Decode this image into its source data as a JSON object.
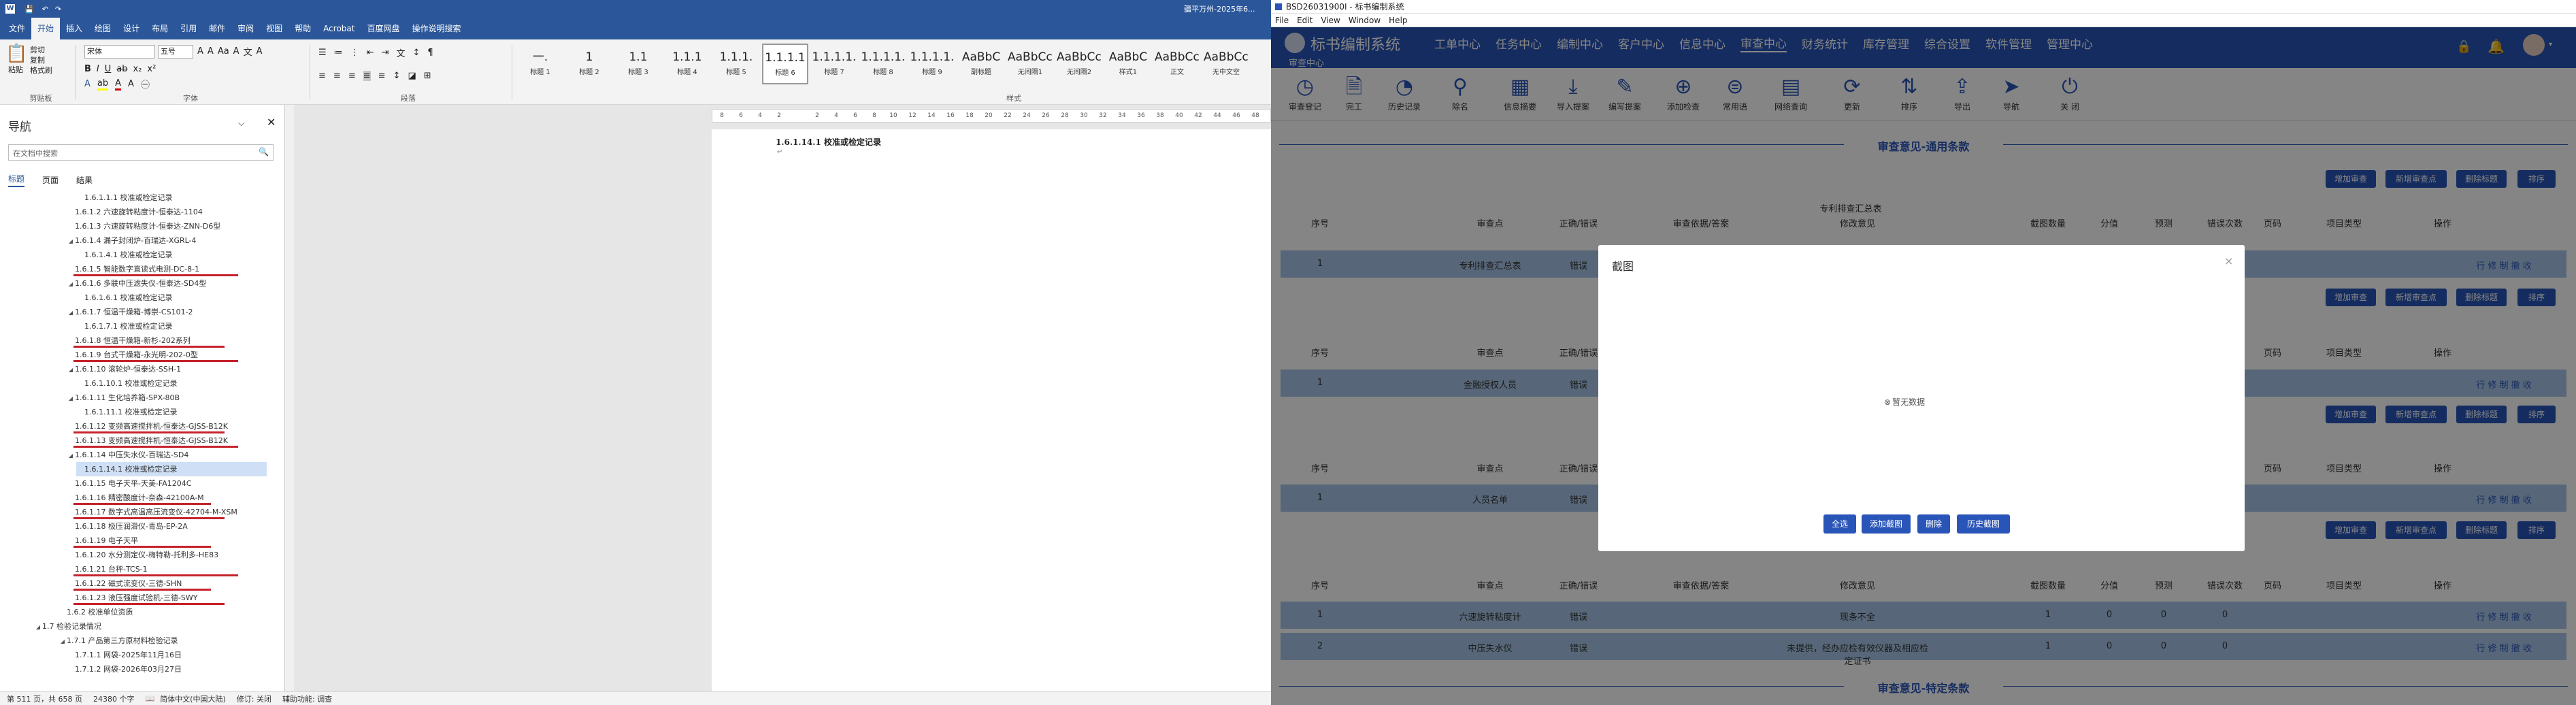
{
  "word": {
    "title": "疆平万州-2025年6...",
    "tabs": [
      "文件",
      "开始",
      "插入",
      "绘图",
      "设计",
      "布局",
      "引用",
      "邮件",
      "审阅",
      "视图",
      "帮助",
      "Acrobat",
      "百度网盘",
      "操作说明搜索"
    ],
    "font_name": "宋体",
    "font_size": "五号",
    "groups": [
      "剪贴板",
      "字体",
      "段落",
      "样式"
    ],
    "paste": "粘贴",
    "clipboard_items": [
      "剪切",
      "复制",
      "格式刷"
    ],
    "styles": [
      {
        "preview": "一.",
        "name": "标题 1"
      },
      {
        "preview": "1",
        "name": "标题 2"
      },
      {
        "preview": "1.1",
        "name": "标题 3"
      },
      {
        "preview": "1.1.1",
        "name": "标题 4"
      },
      {
        "preview": "1.1.1.",
        "name": "标题 5"
      },
      {
        "preview": "1.1.1.1",
        "name": "标题 6"
      },
      {
        "preview": "1.1.1.1.",
        "name": "标题 7"
      },
      {
        "preview": "1.1.1.1.",
        "name": "标题 8"
      },
      {
        "preview": "1.1.1.1.",
        "name": "标题 9"
      },
      {
        "preview": "AaBbC",
        "name": "副标题"
      },
      {
        "preview": "AaBbCcDd",
        "name": "无间隔1"
      },
      {
        "preview": "AaBbCcDd",
        "name": "无间隔2"
      },
      {
        "preview": "AaBbC",
        "name": "样式1"
      },
      {
        "preview": "AaBbCcDd",
        "name": "正文"
      },
      {
        "preview": "AaBbCcDd",
        "name": "无中文空"
      }
    ],
    "nav": {
      "title": "导航",
      "search_placeholder": "在文档中搜索",
      "tabs": [
        "标题",
        "页面",
        "结果"
      ],
      "items": [
        {
          "text": "1.6.1.1.1 校准或检定记录",
          "level": 4
        },
        {
          "text": "1.6.1.2 六速旋转粘度计-恒泰达-1104",
          "level": 3
        },
        {
          "text": "1.6.1.3 六速旋转粘度计-恒泰达-ZNN-D6型",
          "level": 3
        },
        {
          "text": "1.6.1.4 漏子封闭炉-百瑞达-XGRL-4",
          "level": 3
        },
        {
          "text": "1.6.1.4.1 校准或检定记录",
          "level": 4
        },
        {
          "text": "1.6.1.5 智能数字直读式电测-DC-8-1",
          "level": 3
        },
        {
          "text": "1.6.1.6 多联中压滤失仪-恒泰达-SD4型",
          "level": 3
        },
        {
          "text": "1.6.1.6.1 校准或检定记录",
          "level": 4
        },
        {
          "text": "1.6.1.7 恒温干燥箱-博崇-CS101-2",
          "level": 3
        },
        {
          "text": "1.6.1.7.1 校准或检定记录",
          "level": 4
        },
        {
          "text": "1.6.1.8 恒温干燥箱-新杉-202系列",
          "level": 3
        },
        {
          "text": "1.6.1.9 台式干燥箱-永光明-202-0型",
          "level": 3
        },
        {
          "text": "1.6.1.10 滚轮炉-恒泰达-SSH-1",
          "level": 3
        },
        {
          "text": "1.6.1.10.1 校准或检定记录",
          "level": 4
        },
        {
          "text": "1.6.1.11 生化培养箱-SPX-80B",
          "level": 3
        },
        {
          "text": "1.6.1.11.1 校准或检定记录",
          "level": 4
        },
        {
          "text": "1.6.1.12 变频高速搅拌机-恒泰达-GJSS-B12K",
          "level": 3
        },
        {
          "text": "1.6.1.13 变频高速搅拌机-恒泰达-GJSS-B12K",
          "level": 3
        },
        {
          "text": "1.6.1.14 中压失水仪-百瑞达-SD4",
          "level": 3
        },
        {
          "text": "1.6.1.14.1 校准或检定记录",
          "level": 4
        },
        {
          "text": "1.6.1.15 电子天平-天美-FA1204C",
          "level": 3
        },
        {
          "text": "1.6.1.16 精密酸度计-奈森-42100A-M",
          "level": 3
        },
        {
          "text": "1.6.1.17 数字式高温高压流变仪-42704-M-XSM",
          "level": 3
        },
        {
          "text": "1.6.1.18 极压润滑仪-青岛-EP-2A",
          "level": 3
        },
        {
          "text": "1.6.1.19 电子天平",
          "level": 3
        },
        {
          "text": "1.6.1.20 水分测定仪-梅特勒-托利多-HE83",
          "level": 3
        },
        {
          "text": "1.6.1.21 台秤-TCS-1",
          "level": 3
        },
        {
          "text": "1.6.1.22 磁式流变仪-三德-SHN",
          "level": 3
        },
        {
          "text": "1.6.1.23 液压强度试验机-三德-SWY",
          "level": 3
        },
        {
          "text": "1.6.2 校准单位资质",
          "level": 2
        },
        {
          "text": "1.7 检验记录情况",
          "level": 1
        },
        {
          "text": "1.7.1 产品第三方原材料检验记录",
          "level": 2
        },
        {
          "text": "1.7.1.1 网袋-2025年11月16日",
          "level": 3
        },
        {
          "text": "1.7.1.2 网袋-2026年03月27日",
          "level": 3
        }
      ]
    },
    "doc_heading": "1.6.1.14.1 校准或检定记录",
    "ruler_marks": [
      "8",
      "6",
      "4",
      "2",
      "",
      "2",
      "4",
      "6",
      "8",
      "10",
      "12",
      "14",
      "16",
      "18",
      "20",
      "22",
      "24",
      "26",
      "28",
      "30",
      "32",
      "34",
      "36",
      "38",
      "40",
      "42",
      "44",
      "46",
      "48"
    ],
    "status": {
      "page": "第 511 页，共 658 页",
      "words": "24380 个字",
      "lang": "简体中文(中国大陆)",
      "revision": "修订: 关闭",
      "accessibility": "辅助功能: 调查"
    }
  },
  "app": {
    "window_title": "BSD26031900I - 标书编制系统",
    "menu": [
      "File",
      "Edit",
      "View",
      "Window",
      "Help"
    ],
    "brand": "标书编制系统",
    "breadcrumb": "审查中心",
    "topnav": [
      "工单中心",
      "任务中心",
      "编制中心",
      "客户中心",
      "信息中心",
      "审查中心",
      "财务统计",
      "库存管理",
      "综合设置",
      "软件管理",
      "管理中心"
    ],
    "toolbar": [
      {
        "icon": "clock-icon",
        "label": "审查登记"
      },
      {
        "icon": "document-icon",
        "label": "完工"
      },
      {
        "icon": "history-icon",
        "label": "历史记录"
      },
      {
        "icon": "stamp-icon",
        "label": "除名"
      },
      {
        "icon": "calendar-icon",
        "label": "信息摘要"
      },
      {
        "icon": "download-icon",
        "label": "导入提案"
      },
      {
        "icon": "pen-icon",
        "label": "编写提案"
      },
      {
        "icon": "plus-circle-icon",
        "label": "添加检查"
      },
      {
        "icon": "equal-circle-icon",
        "label": "常用语"
      },
      {
        "icon": "report-icon",
        "label": "网络查询"
      },
      {
        "icon": "refresh-icon",
        "label": "更新"
      },
      {
        "icon": "sort-icon",
        "label": "排序"
      },
      {
        "icon": "export-icon",
        "label": "导出"
      },
      {
        "icon": "navigate-icon",
        "label": "导航"
      },
      {
        "icon": "power-icon",
        "label": "关 闭"
      }
    ],
    "section_general": "审查意见-通用条款",
    "section_specific": "审查意见-特定条款",
    "sub_title": "专利排查汇总表",
    "row_buttons": [
      "增加审查",
      "新增审查点",
      "删除标题",
      "排序"
    ],
    "columns": [
      "序号",
      "审查点",
      "正确/错误",
      "审查依据/答案",
      "修改意见",
      "截图数量",
      "分值",
      "预测",
      "错误次数",
      "页码",
      "项目类型",
      "操作"
    ],
    "rows": [
      {
        "no": "1",
        "point": "专利排查汇总表",
        "status": "错误",
        "opinion": ""
      },
      {
        "no": "1",
        "point": "金融授权人员",
        "status": "错误",
        "opinion": ""
      },
      {
        "no": "1",
        "point": "人员名单",
        "status": "错误",
        "opinion": ""
      }
    ],
    "table4_rows": [
      {
        "no": "1",
        "point": "六速旋转粘度计",
        "status": "错误",
        "opinion": "现条不全",
        "count": "1",
        "score": "0",
        "pred": "0",
        "err": "0"
      },
      {
        "no": "2",
        "point": "中压失水仪",
        "status": "错误",
        "opinion": "未提供，经办应检有效仪器及相应检定证书",
        "count": "1",
        "score": "0",
        "pred": "0",
        "err": "0"
      }
    ],
    "op_links": "行 修 制 撤 收",
    "modal": {
      "title": "截图",
      "empty": "暂无数据",
      "buttons": [
        "全选",
        "添加截图",
        "删除",
        "历史截图"
      ]
    }
  }
}
